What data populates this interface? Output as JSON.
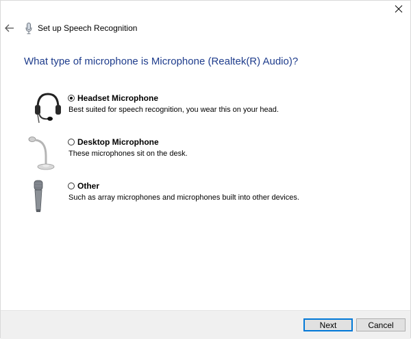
{
  "window": {
    "close_icon": "close-icon",
    "back_icon": "back-arrow-icon",
    "title_icon": "microphone-icon",
    "title": "Set up Speech Recognition"
  },
  "main": {
    "heading": "What type of microphone is Microphone (Realtek(R) Audio)?",
    "options": [
      {
        "label": "Headset Microphone",
        "description": "Best suited for speech recognition, you wear this on your head.",
        "selected": true,
        "image": "headset-microphone"
      },
      {
        "label": "Desktop Microphone",
        "description": "These microphones sit on the desk.",
        "selected": false,
        "image": "desktop-microphone"
      },
      {
        "label": "Other",
        "description": "Such as array microphones and microphones built into other devices.",
        "selected": false,
        "image": "handheld-microphone"
      }
    ]
  },
  "footer": {
    "next_label": "Next",
    "cancel_label": "Cancel"
  },
  "colors": {
    "heading": "#1e3c8c",
    "primary_border": "#0078d7",
    "footer_bg": "#f0f0f0"
  }
}
